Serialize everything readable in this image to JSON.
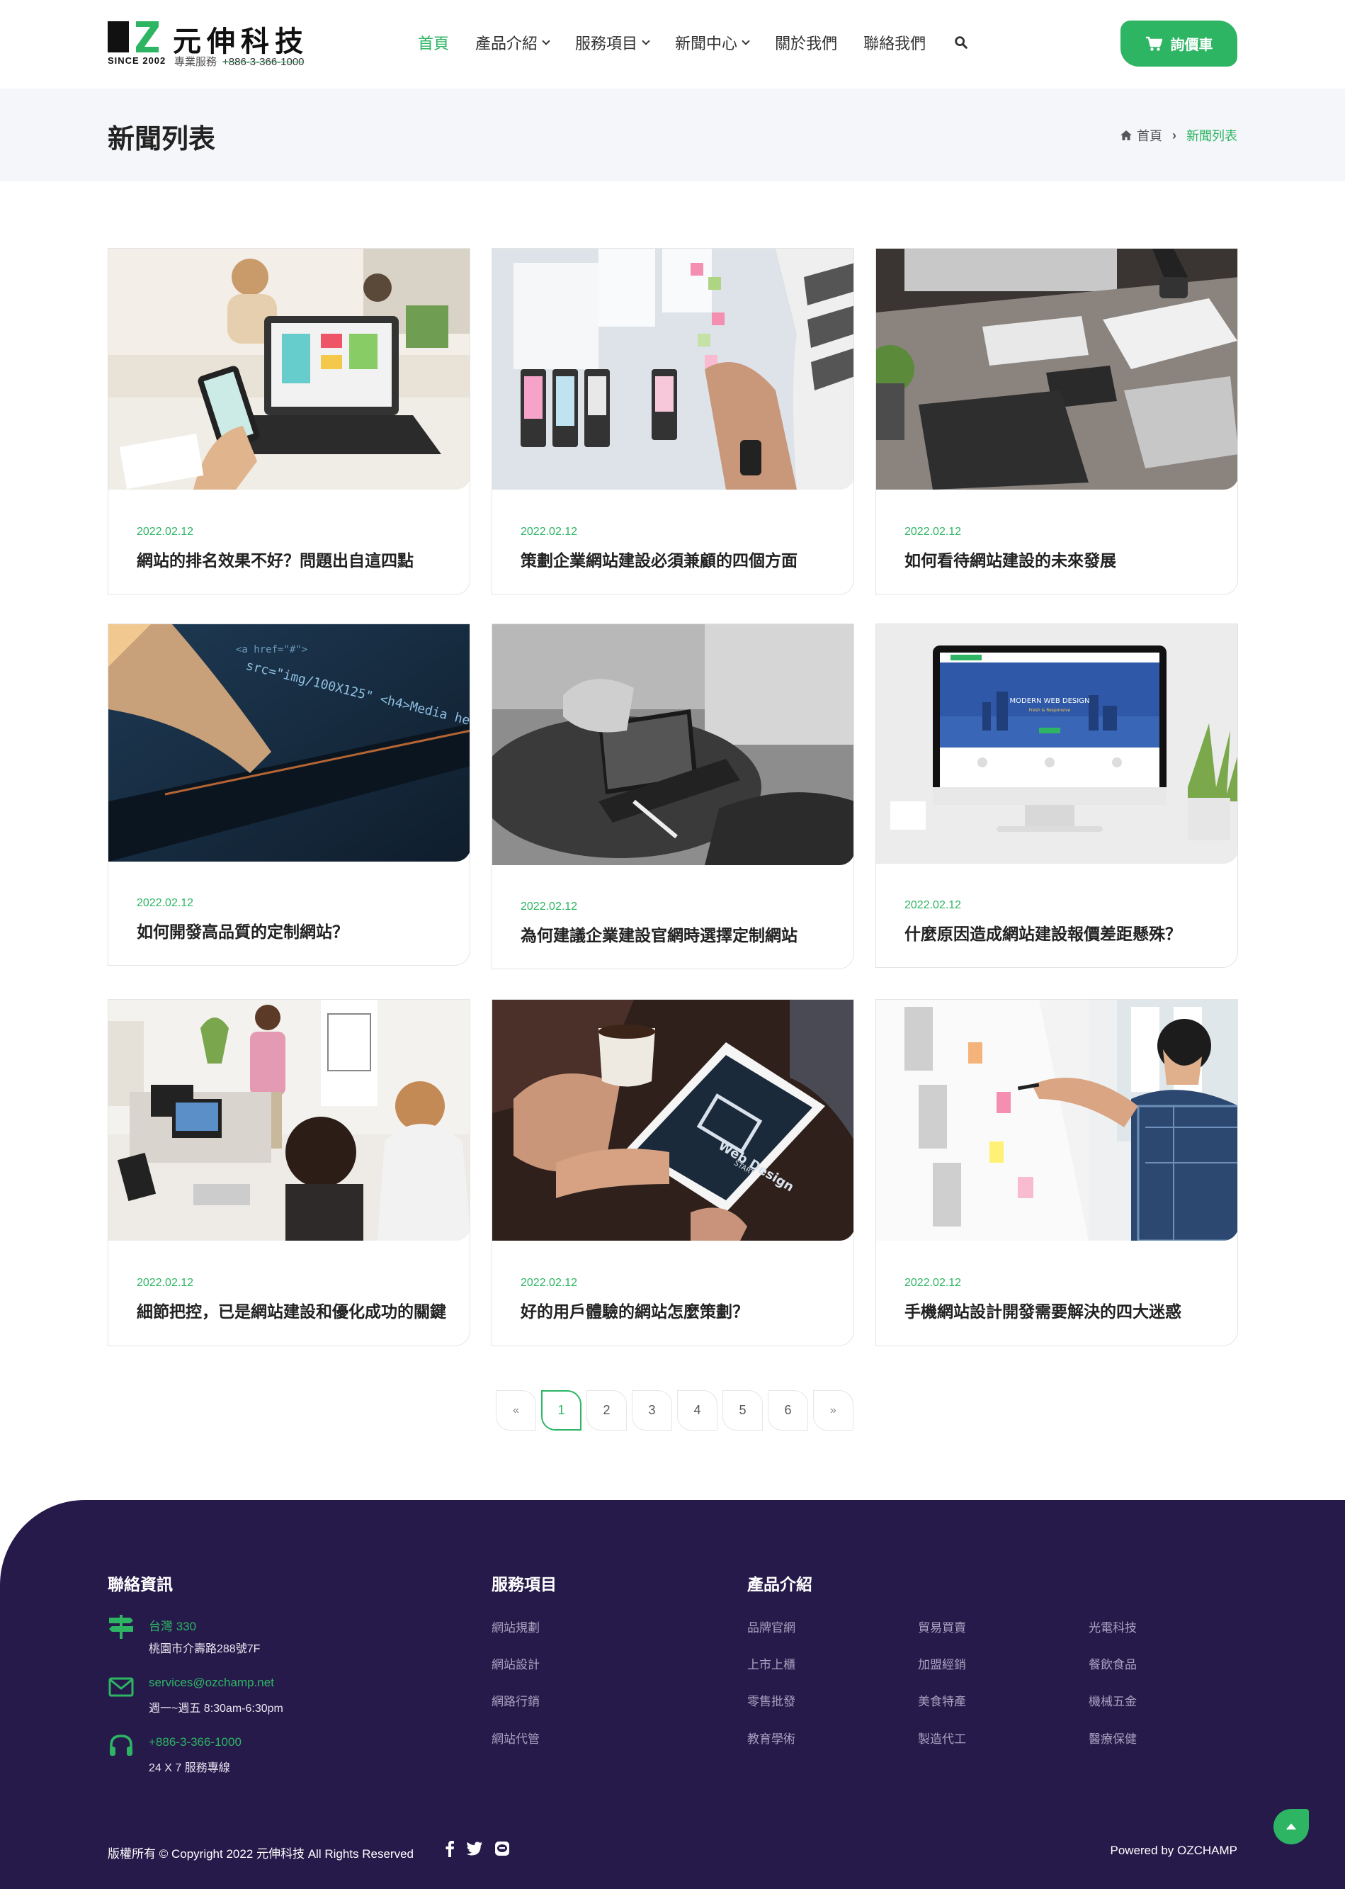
{
  "brand": {
    "name": "元伸科技",
    "since": "SINCE 2002",
    "service_label": "專業服務",
    "phone": "+886-3-366-1000"
  },
  "nav": {
    "items": [
      {
        "label": "首頁"
      },
      {
        "label": "產品介紹"
      },
      {
        "label": "服務項目"
      },
      {
        "label": "新聞中心"
      },
      {
        "label": "關於我們"
      },
      {
        "label": "聯絡我們"
      }
    ],
    "quote_button": "詢價車"
  },
  "page": {
    "title": "新聞列表",
    "breadcrumb_home": "首頁",
    "breadcrumb_current": "新聞列表"
  },
  "articles": [
    {
      "date": "2022.02.12",
      "title": "網站的排名效果不好？問題出自這四點"
    },
    {
      "date": "2022.02.12",
      "title": "策劃企業網站建設必須兼顧的四個方面"
    },
    {
      "date": "2022.02.12",
      "title": "如何看待網站建設的未來發展"
    },
    {
      "date": "2022.02.12",
      "title": "如何開發高品質的定制網站？"
    },
    {
      "date": "2022.02.12",
      "title": "為何建議企業建設官網時選擇定制網站"
    },
    {
      "date": "2022.02.12",
      "title": "什麼原因造成網站建設報價差距懸殊？"
    },
    {
      "date": "2022.02.12",
      "title": "細節把控，已是網站建設和優化成功的關鍵"
    },
    {
      "date": "2022.02.12",
      "title": "好的用戶體驗的網站怎麼策劃？"
    },
    {
      "date": "2022.02.12",
      "title": "手機網站設計開發需要解決的四大迷惑"
    }
  ],
  "image_texts": {
    "web_design": "Web Design",
    "start": "START",
    "modern": "MODERN WEB DESIGN",
    "responsive": "Fresh & Responsive",
    "code": "src=\"img/100X125\" <h4>Media heading</h4>"
  },
  "pagination": {
    "prev": "«",
    "pages": [
      "1",
      "2",
      "3",
      "4",
      "5",
      "6"
    ],
    "next": "»",
    "current": "1"
  },
  "footer": {
    "contact_heading": "聯絡資訊",
    "services_heading": "服務項目",
    "products_heading": "產品介紹",
    "contacts": [
      {
        "main": "台灣 330",
        "sub": "桃園市介壽路288號7F"
      },
      {
        "main": "services@ozchamp.net",
        "sub": "週一~週五 8:30am-6:30pm"
      },
      {
        "main": "+886-3-366-1000",
        "sub": "24 X 7 服務專線"
      }
    ],
    "services": [
      "網站規劃",
      "網站設計",
      "網路行銷",
      "網站代管"
    ],
    "products": [
      [
        "品牌官網",
        "上市上櫃",
        "零售批發",
        "教育學術"
      ],
      [
        "貿易買賣",
        "加盟經銷",
        "美食特產",
        "製造代工"
      ],
      [
        "光電科技",
        "餐飲食品",
        "機械五金",
        "醫療保健"
      ]
    ],
    "copyright": "版權所有 © Copyright 2022 元伸科技 All Rights Reserved",
    "powered": "Powered by OZCHAMP"
  },
  "colors": {
    "accent": "#2db564",
    "footer_bg": "#261a4a",
    "title_band": "#f4f6f9"
  }
}
